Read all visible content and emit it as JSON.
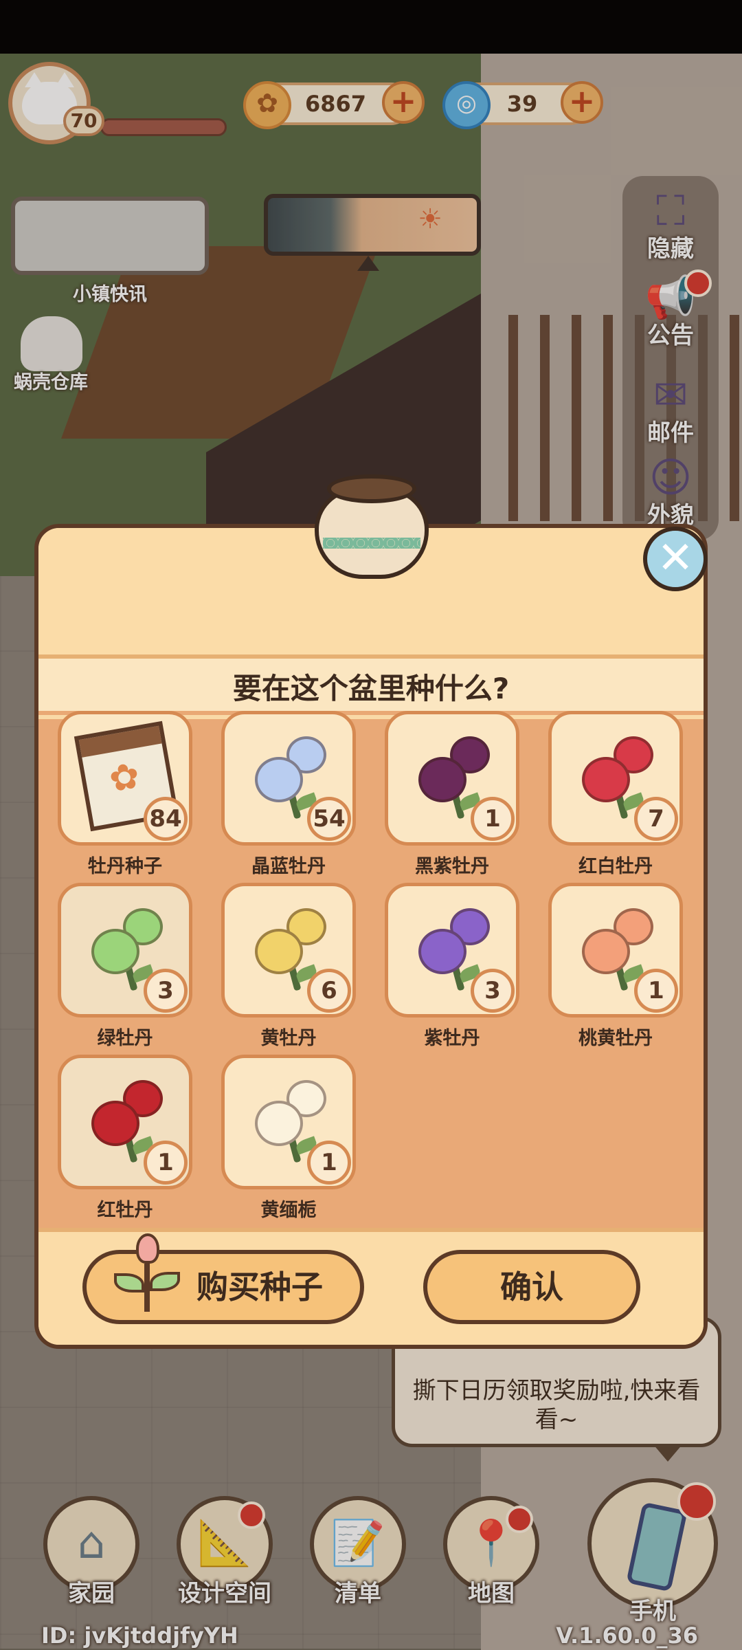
{
  "hud": {
    "level": "70",
    "coins": "6867",
    "gems": "39",
    "news_label": "小镇快讯",
    "warehouse_label": "蜗壳仓库"
  },
  "side_menu": [
    {
      "label": "隐藏",
      "icon": "fullscreen-bracket-icon"
    },
    {
      "label": "公告",
      "icon": "megaphone-icon"
    },
    {
      "label": "邮件",
      "icon": "envelope-icon"
    },
    {
      "label": "外貌",
      "icon": "character-face-icon"
    }
  ],
  "dialog": {
    "question": "要在这个盆里种什么?",
    "buy_label": "购买种子",
    "confirm_label": "确认",
    "seeds": [
      {
        "name": "牡丹种子",
        "count": "84",
        "color": "#f0a070",
        "type": "packet"
      },
      {
        "name": "晶蓝牡丹",
        "count": "54",
        "color": "#b9cdf0",
        "type": "flower"
      },
      {
        "name": "黑紫牡丹",
        "count": "1",
        "color": "#6b2a5a",
        "type": "flower"
      },
      {
        "name": "红白牡丹",
        "count": "7",
        "color": "#d83a48",
        "type": "flower"
      },
      {
        "name": "绿牡丹",
        "count": "3",
        "color": "#9bd47a",
        "type": "flower"
      },
      {
        "name": "黄牡丹",
        "count": "6",
        "color": "#f1d26a",
        "type": "flower"
      },
      {
        "name": "紫牡丹",
        "count": "3",
        "color": "#8a63c9",
        "type": "flower"
      },
      {
        "name": "桃黄牡丹",
        "count": "1",
        "color": "#f3a07a",
        "type": "flower"
      },
      {
        "name": "红牡丹",
        "count": "1",
        "color": "#c3262e",
        "type": "flower"
      },
      {
        "name": "黄缅栀",
        "count": "1",
        "color": "#fbf2dd",
        "type": "flower"
      }
    ]
  },
  "calendar_tip": "撕下日历领取奖励啦,快来看看~",
  "nav": [
    {
      "label": "家园",
      "icon": "house-icon"
    },
    {
      "label": "设计空间",
      "icon": "design-tools-icon"
    },
    {
      "label": "清单",
      "icon": "checklist-icon"
    },
    {
      "label": "地图",
      "icon": "map-pin-icon"
    },
    {
      "label": "手机",
      "icon": "phone-icon"
    }
  ],
  "footer": {
    "user_id": "ID: jvKjtddjfyYH",
    "version": "V.1.60.0_36"
  }
}
